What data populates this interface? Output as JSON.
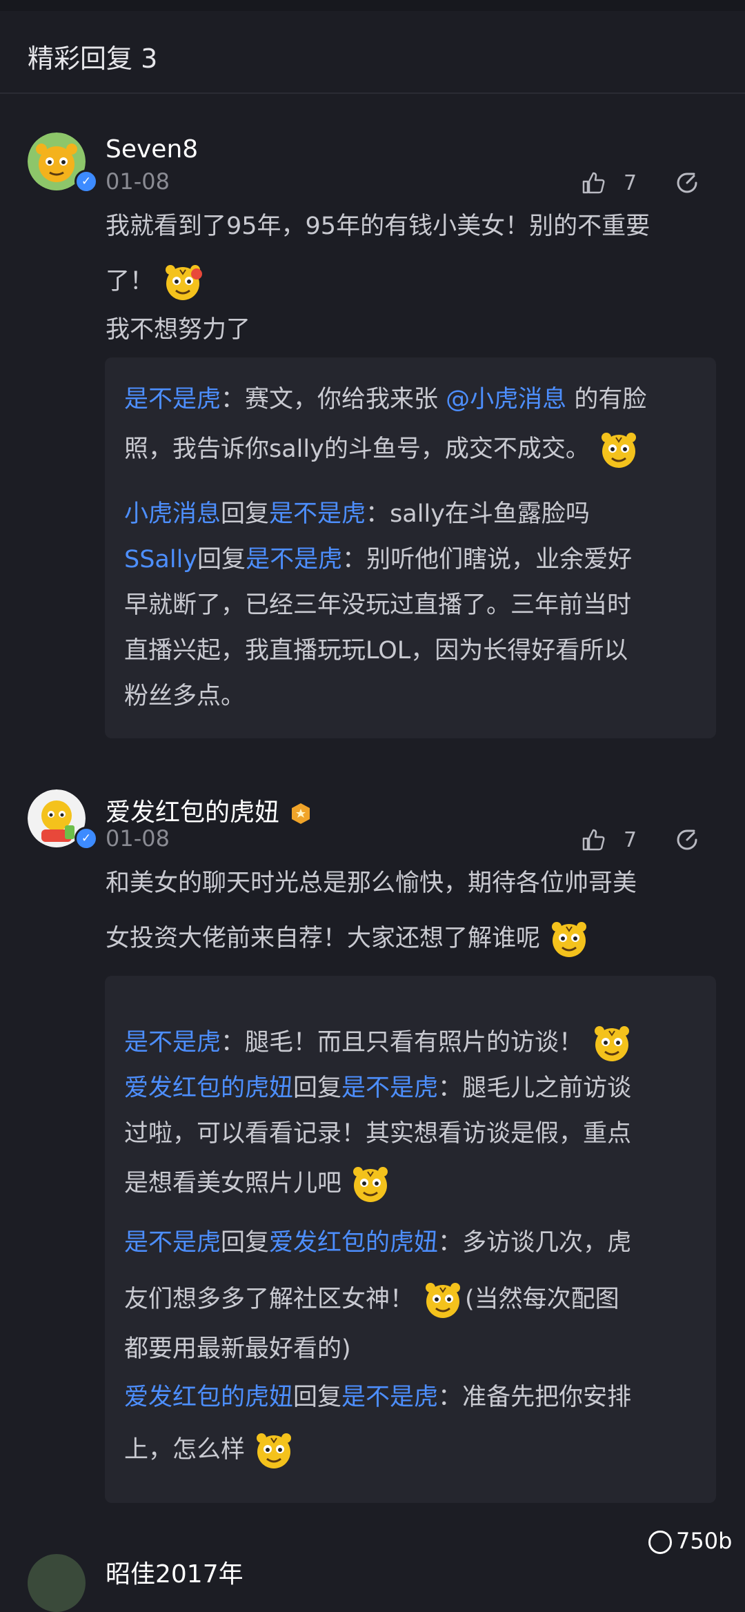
{
  "header": {
    "title": "精彩回复 3"
  },
  "comments": [
    {
      "username": "Seven8",
      "date": "01-08",
      "likes": "7",
      "body": {
        "line1": "我就看到了95年，95年的有钱小美女！别的不重要",
        "line2": "了！",
        "line3": "我不想努力了"
      },
      "replies": {
        "r1": {
          "user": "是不是虎",
          "sep": "：",
          "t1": "赛文，你给我来张 ",
          "mention": "@小虎消息",
          "t2": " 的有脸",
          "t3": "照，我告诉你sally的斗鱼号，成交不成交。"
        },
        "r2": {
          "user": "小虎消息",
          "word": "回复",
          "target": "是不是虎",
          "sep": "：",
          "text": "sally在斗鱼露脸吗"
        },
        "r3": {
          "user": "SSally",
          "word": "回复",
          "target": "是不是虎",
          "sep": "：",
          "t1": "别听他们瞎说，业余爱好",
          "t2": "早就断了，已经三年没玩过直播了。三年前当时",
          "t3": "直播兴起，我直播玩玩LOL，因为长得好看所以",
          "t4": "粉丝多点。"
        }
      }
    },
    {
      "username": "爱发红包的虎妞",
      "date": "01-08",
      "likes": "7",
      "body": {
        "line1": "和美女的聊天时光总是那么愉快，期待各位帅哥美",
        "line2": "女投资大佬前来自荐！大家还想了解谁呢"
      },
      "replies": {
        "r1": {
          "user": "是不是虎",
          "sep": "：",
          "text": "腿毛！而且只看有照片的访谈！"
        },
        "r2": {
          "user": "爱发红包的虎妞",
          "word": "回复",
          "target": "是不是虎",
          "sep": "：",
          "t1": "腿毛儿之前访谈",
          "t2": "过啦，可以看看记录！其实想看访谈是假，重点",
          "t3": "是想看美女照片儿吧"
        },
        "r3": {
          "user": "是不是虎",
          "word": "回复",
          "target": "爱发红包的虎妞",
          "sep": "：",
          "t1": "多访谈几次，虎",
          "t2": "友们想多多了解社区女神！",
          "t3": "(当然每次配图",
          "t4": "都要用最新最好看的)"
        },
        "r4": {
          "user": "爱发红包的虎妞",
          "word": "回复",
          "target": "是不是虎",
          "sep": "：",
          "t1": "准备先把你安排",
          "t2": "上，怎么样"
        }
      }
    },
    {
      "username": "昭佳2017年"
    }
  ],
  "footer": {
    "count": "750b"
  },
  "colors": {
    "accent": "#4d8fff",
    "background": "#1c1d24",
    "card": "#25262e"
  }
}
